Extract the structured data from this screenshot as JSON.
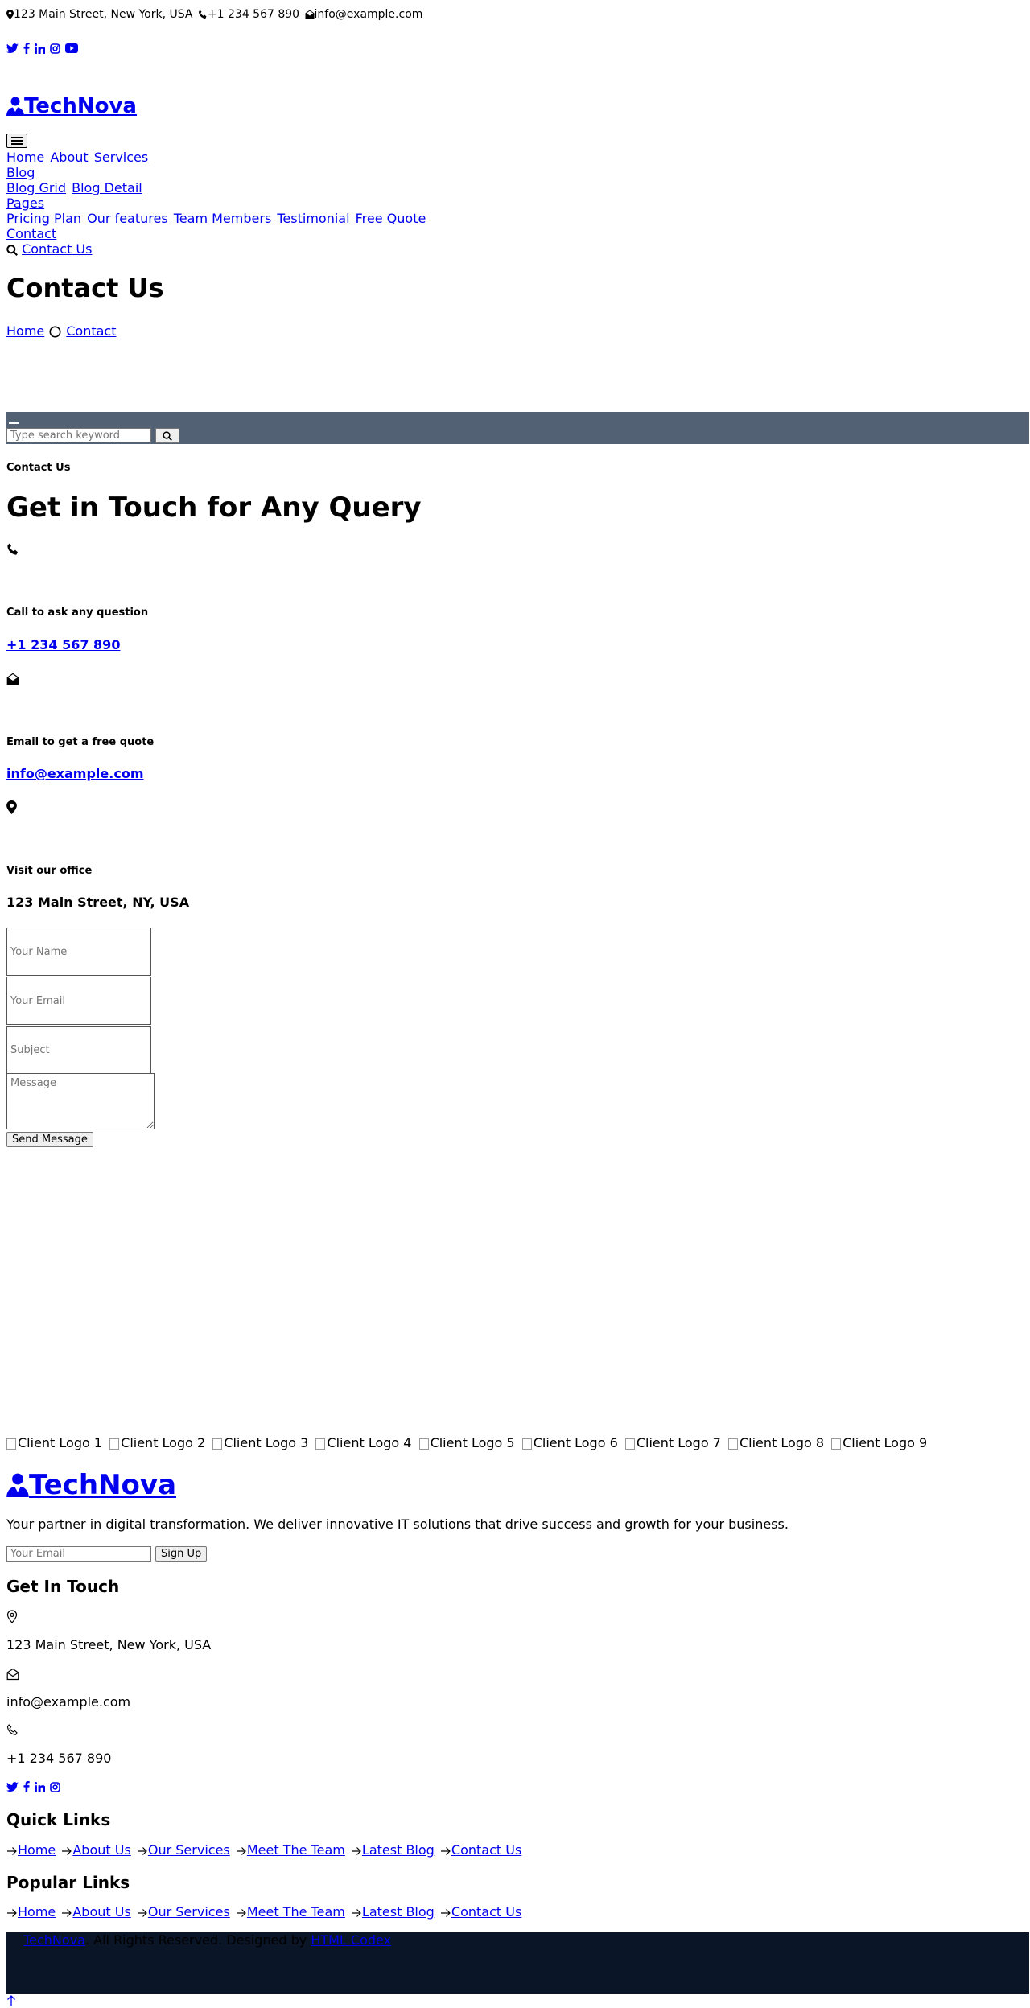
{
  "topbar": {
    "address": "123 Main Street, New York, USA",
    "phone": "+1 234 567 890",
    "email": "info@example.com"
  },
  "social_top": [
    "twitter-icon",
    "facebook-icon",
    "linkedin-icon",
    "instagram-icon",
    "youtube-icon"
  ],
  "brand": {
    "name": "TechNova"
  },
  "nav": {
    "toggler_icon": "hamburger-icon",
    "home": "Home",
    "about": "About",
    "services": "Services",
    "blog": "Blog",
    "blog_grid": "Blog Grid",
    "blog_detail": "Blog Detail",
    "pages": "Pages",
    "pricing_plan": "Pricing Plan",
    "our_features": "Our features",
    "team_members": "Team Members",
    "testimonial": "Testimonial",
    "free_quote": "Free Quote",
    "contact": "Contact",
    "contact_us": "Contact Us"
  },
  "hero": {
    "title": "Contact Us",
    "breadcrumb_home": "Home",
    "breadcrumb_current": "Contact"
  },
  "search": {
    "placeholder": "Type search keyword"
  },
  "contact": {
    "subtitle": "Contact Us",
    "heading": "Get in Touch for Any Query",
    "call_label": "Call to ask any question",
    "call_value": "+1 234 567 890",
    "email_label": "Email to get a free quote",
    "email_value": "info@example.com",
    "office_label": "Visit our office",
    "office_value": "123 Main Street, NY, USA"
  },
  "form": {
    "name_placeholder": "Your Name",
    "email_placeholder": "Your Email",
    "subject_placeholder": "Subject",
    "message_placeholder": "Message",
    "submit_label": "Send Message"
  },
  "clients": [
    "Client Logo 1",
    "Client Logo 2",
    "Client Logo 3",
    "Client Logo 4",
    "Client Logo 5",
    "Client Logo 6",
    "Client Logo 7",
    "Client Logo 8",
    "Client Logo 9"
  ],
  "footer": {
    "brand": "TechNova",
    "tagline": "Your partner in digital transformation. We deliver innovative IT solutions that drive success and growth for your business.",
    "newsletter_placeholder": "Your Email",
    "newsletter_button": "Sign Up",
    "get_in_touch_title": "Get In Touch",
    "address": "123 Main Street, New York, USA",
    "email": "info@example.com",
    "phone": "+1 234 567 890",
    "quick_links_title": "Quick Links",
    "popular_links_title": "Popular Links",
    "links": [
      "Home",
      "About Us",
      "Our Services",
      "Meet The Team",
      "Latest Blog",
      "Contact Us"
    ],
    "copyright_brand": "TechNova",
    "copyright_text": ". All Rights Reserved. Designed by",
    "designer": "HTML Codex",
    "back_to_top_icon": "arrow-up-icon"
  },
  "colors": {
    "search_band": "#536175",
    "copyright_band": "#0a1528",
    "link": "#0000ee"
  }
}
